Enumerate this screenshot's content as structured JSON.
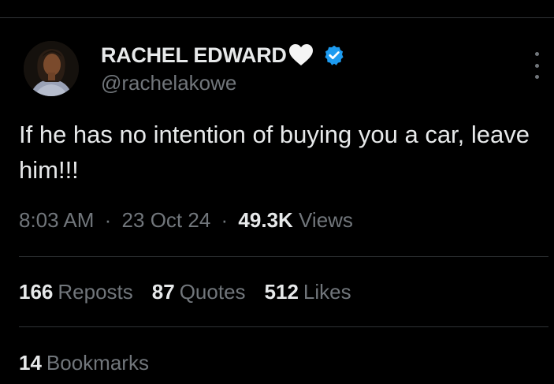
{
  "author": {
    "display_name": "RACHEL EDWARD",
    "name_emoji": "white-heart-icon",
    "verified": true,
    "verified_color": "#1d9bf0",
    "handle": "@rachelakowe"
  },
  "tweet": {
    "text": "If he has no intention of buying you a car, leave him!!!"
  },
  "meta": {
    "time": "8:03 AM",
    "separator": "·",
    "date": "23 Oct 24",
    "views_count": "49.3K",
    "views_label": "Views"
  },
  "stats": {
    "reposts_count": "166",
    "reposts_label": "Reposts",
    "quotes_count": "87",
    "quotes_label": "Quotes",
    "likes_count": "512",
    "likes_label": "Likes",
    "bookmarks_count": "14",
    "bookmarks_label": "Bookmarks"
  },
  "colors": {
    "background": "#000000",
    "text_primary": "#e7e9ea",
    "text_secondary": "#71767b",
    "divider": "#2f3336"
  }
}
